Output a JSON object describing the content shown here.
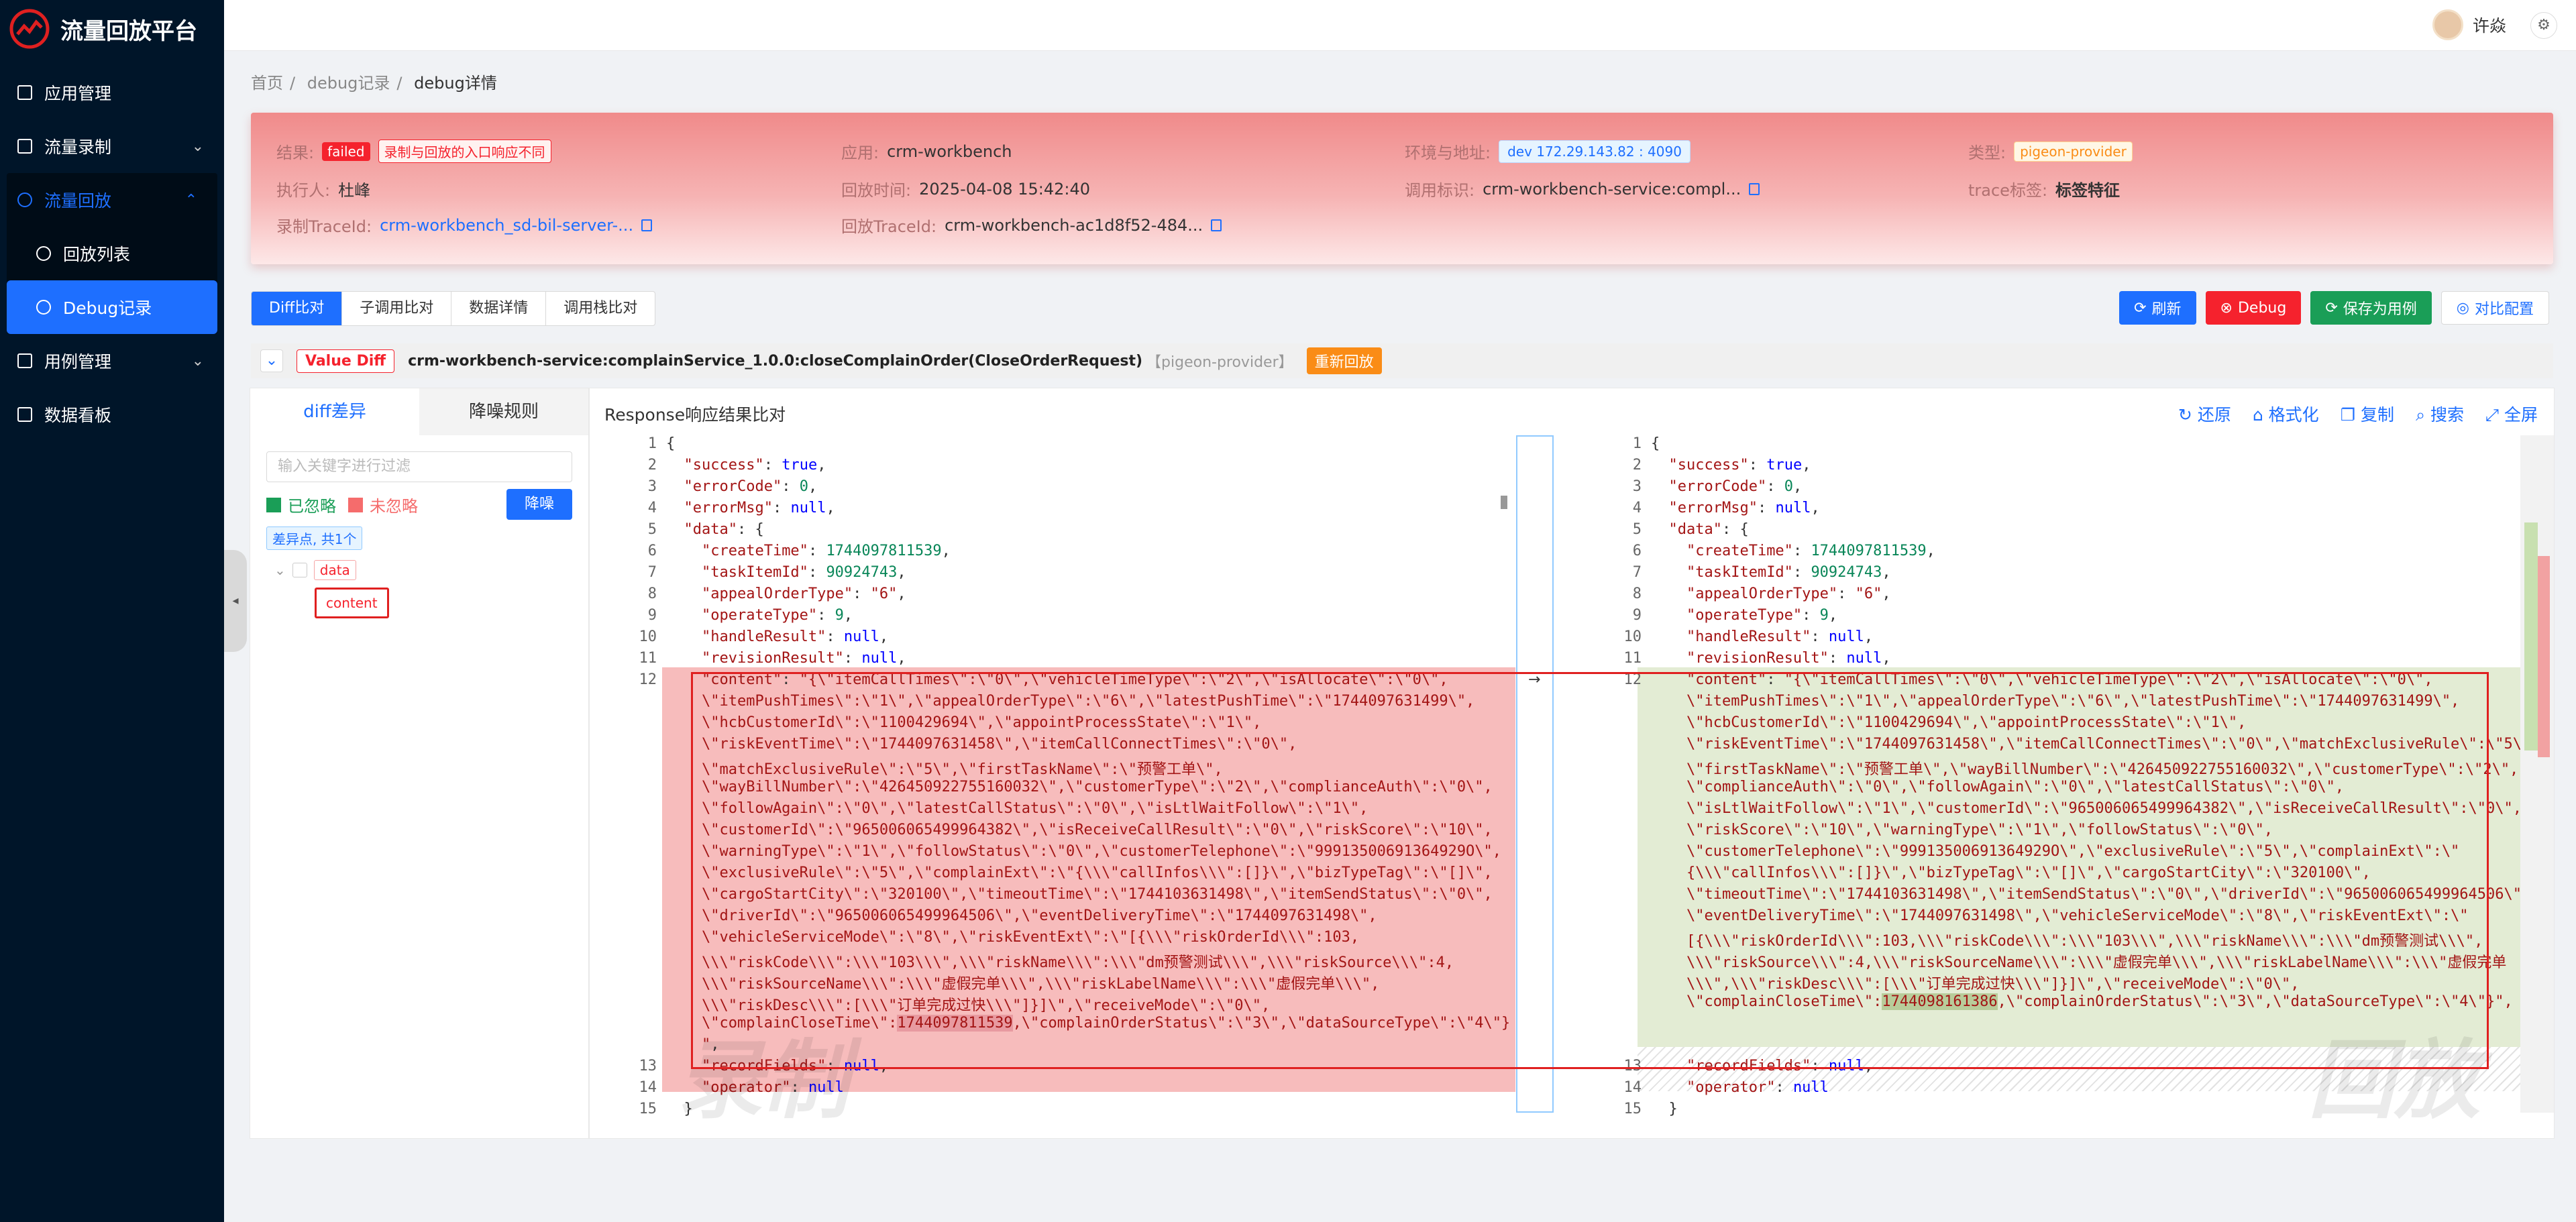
{
  "app": {
    "title": "流量回放平台"
  },
  "sidebar": {
    "items": [
      {
        "label": "应用管理"
      },
      {
        "label": "流量录制"
      },
      {
        "label": "流量回放"
      },
      {
        "label": "回放列表"
      },
      {
        "label": "Debug记录"
      },
      {
        "label": "用例管理"
      },
      {
        "label": "数据看板"
      }
    ]
  },
  "topbar": {
    "user_name": "许焱"
  },
  "breadcrumb": {
    "items": [
      "首页",
      "debug记录",
      "debug详情"
    ]
  },
  "info": {
    "result_label": "结果:",
    "result_status": "failed",
    "result_msg": "录制与回放的入口响应不同",
    "executor_label": "执行人:",
    "executor": "杜峰",
    "record_trace_label": "录制TraceId:",
    "record_trace": "crm-workbench_sd-bil-server-...",
    "app_label": "应用:",
    "app": "crm-workbench",
    "replay_time_label": "回放时间:",
    "replay_time": "2025-04-08 15:42:40",
    "replay_trace_label": "回放TraceId:",
    "replay_trace": "crm-workbench-ac1d8f52-484...",
    "env_label": "环境与地址:",
    "env": "dev  172.29.143.82 : 4090",
    "call_label": "调用标识:",
    "call": "crm-workbench-service:compl...",
    "type_label": "类型:",
    "type": "pigeon-provider",
    "trace_tag_label": "trace标签:",
    "trace_tag": "标签特征"
  },
  "tabs": [
    "Diff比对",
    "子调用比对",
    "数据详情",
    "调用栈比对"
  ],
  "actions": {
    "refresh": "刷新",
    "debug": "Debug",
    "save_case": "保存为用例",
    "compare_config": "对比配置"
  },
  "diff_header": {
    "badge": "Value Diff",
    "method": "crm-workbench-service:complainService_1.0.0:closeComplainOrder(CloseOrderRequest)",
    "provider": "【pigeon-provider】",
    "replay_btn": "重新回放"
  },
  "left_panel": {
    "tabs": [
      "diff差异",
      "降噪规则"
    ],
    "filter_placeholder": "输入关键字进行过滤",
    "ignored": "已忽略",
    "not_ignored": "未忽略",
    "denoise_btn": "降噪",
    "diff_count": "差异点, 共1个",
    "tree": {
      "root": "data",
      "child": "content"
    }
  },
  "right_panel": {
    "title": "Response响应结果比对",
    "tools": [
      "还原",
      "格式化",
      "复制",
      "搜索",
      "全屏"
    ]
  },
  "watermarks": {
    "left": "录制",
    "right": "回放"
  },
  "colors": {
    "primary": "#1e6fff",
    "danger": "#f5222d",
    "success": "#1a9e57",
    "diff_remove": "#f7bcbc",
    "diff_add": "#e3ecd4"
  }
}
